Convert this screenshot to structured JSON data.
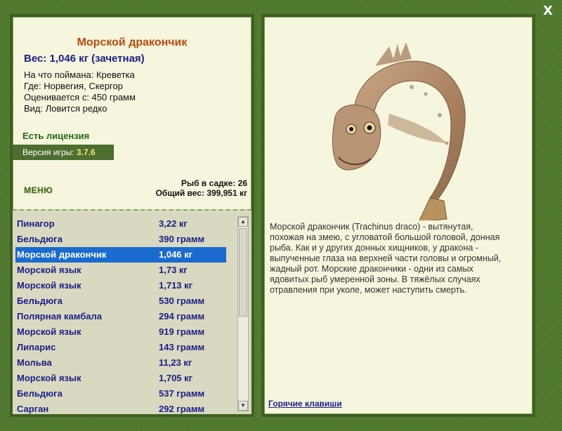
{
  "window": {
    "close_label": "X"
  },
  "fish": {
    "title": "Морской дракончик",
    "weight_line": "Вес: 1,046 кг (зачетная)",
    "info": [
      "На что поймана: Креветка",
      "Где: Норвегия, Скергор",
      "Оценивается с: 450 грамм",
      "Вид: Ловится редко"
    ],
    "license": "Есть лицензия",
    "version_label": "Версия игры:",
    "version_value": "3.7.6",
    "menu_label": "МЕНЮ",
    "stats": {
      "count_line": "Рыб в садке: 26",
      "total_line": "Общий вес: 399,951 кг"
    },
    "description": "Морской дракончик (Trachinus draco) - вытянутая, похожая на змею, с угловатой большой головой, донная рыба. Как и у других донных хищников, у дракона - выпученные глаза на верхней части головы и огромный, жадный рот. Морские дракончики - одни из самых ядовитых рыб умеренной зоны. В тяжёлых случаях отравления при уколе, может наступить смерть.",
    "hotkeys": "Горячие клавиши"
  },
  "list": [
    {
      "name": "Пинагор",
      "weight": "3,22 кг"
    },
    {
      "name": "Бельдюга",
      "weight": "390 грамм"
    },
    {
      "name": "Морской дракончик",
      "weight": "1,046 кг",
      "selected": true
    },
    {
      "name": "Морской язык",
      "weight": "1,73 кг"
    },
    {
      "name": "Морской язык",
      "weight": "1,713 кг"
    },
    {
      "name": "Бельдюга",
      "weight": "530 грамм"
    },
    {
      "name": "Полярная камбала",
      "weight": "294 грамм"
    },
    {
      "name": "Морской язык",
      "weight": "919 грамм"
    },
    {
      "name": "Липарис",
      "weight": "143 грамм"
    },
    {
      "name": "Мольва",
      "weight": "11,23 кг"
    },
    {
      "name": "Морской язык",
      "weight": "1,705 кг"
    },
    {
      "name": "Бельдюга",
      "weight": "537 грамм"
    },
    {
      "name": "Сарган",
      "weight": "292 грамм"
    }
  ],
  "icons": {
    "scroll_up": "▲",
    "scroll_down": "▼"
  }
}
